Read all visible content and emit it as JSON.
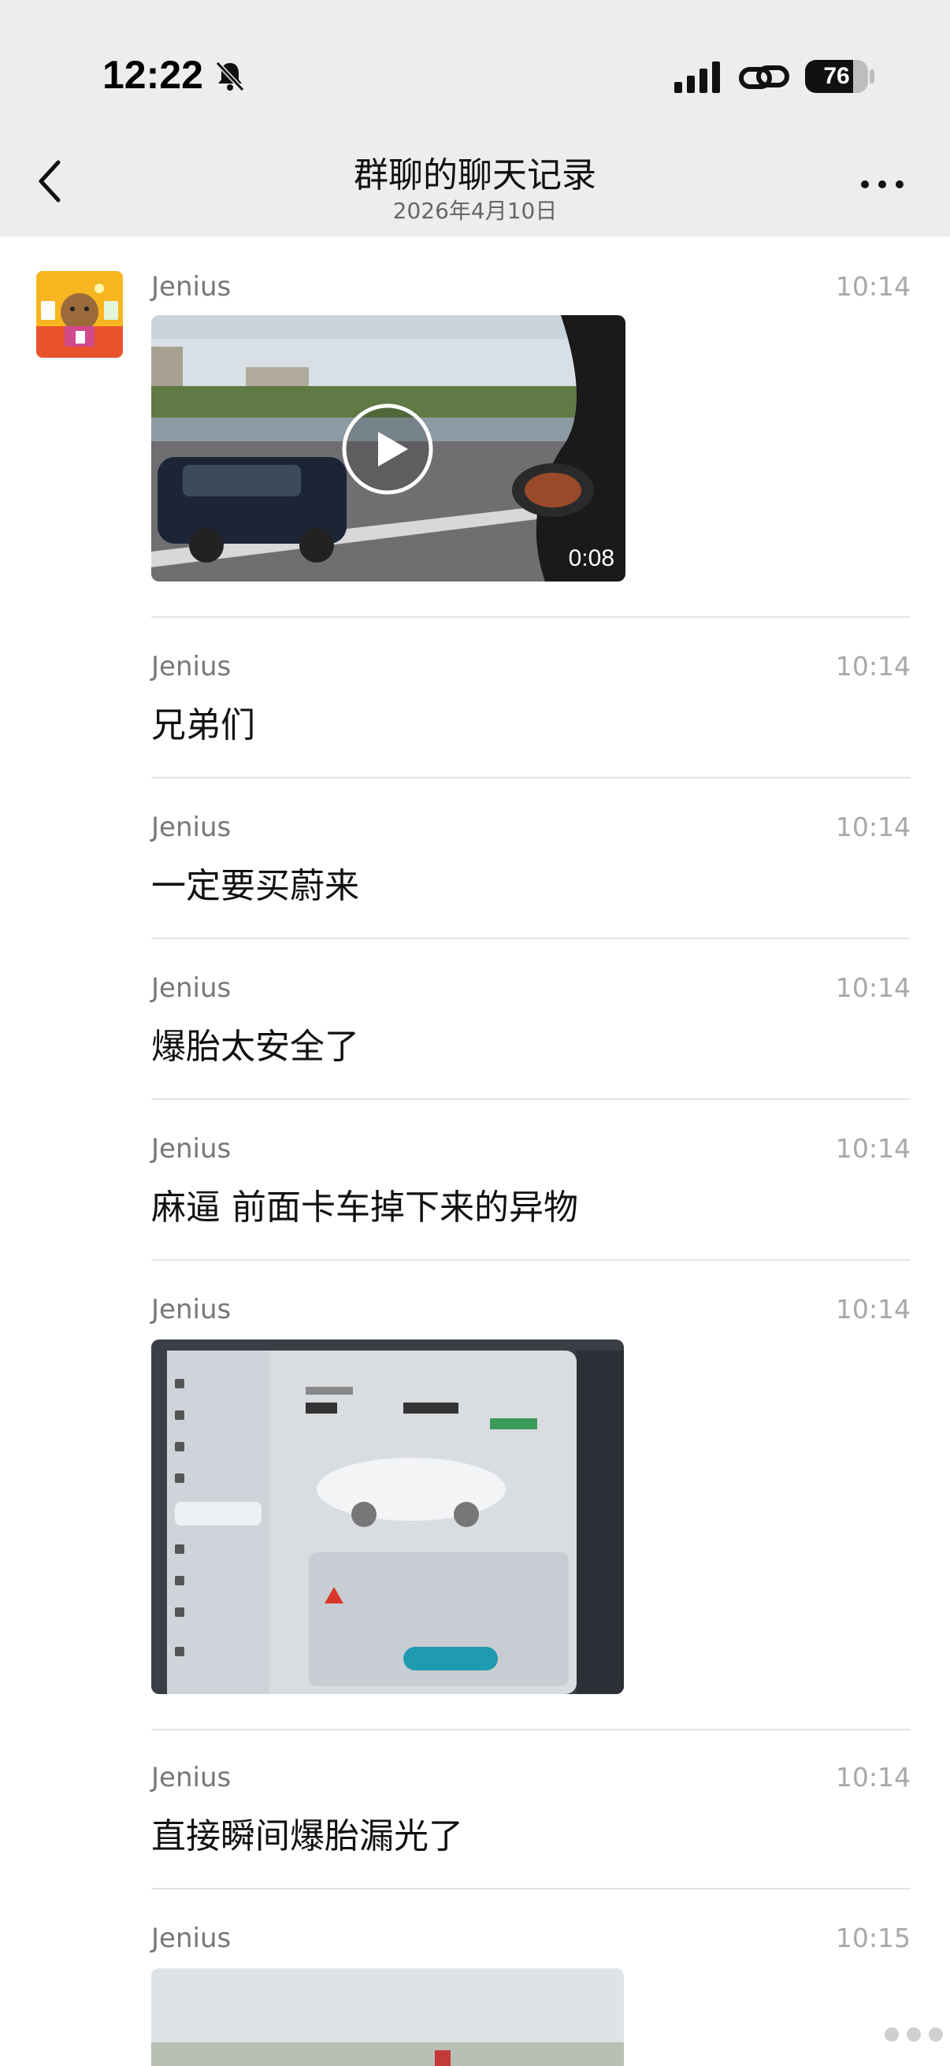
{
  "status_bar": {
    "time": "12:22",
    "battery": "76",
    "battery_level_percent": 76
  },
  "header": {
    "title": "群聊的聊天记录",
    "subtitle": "2026年4月10日"
  },
  "messages": [
    {
      "sender": "Jenius",
      "time": "10:14",
      "type": "video",
      "duration": "0:08"
    },
    {
      "sender": "Jenius",
      "time": "10:14",
      "type": "text",
      "text": "兄弟们"
    },
    {
      "sender": "Jenius",
      "time": "10:14",
      "type": "text",
      "text": "一定要买蔚来"
    },
    {
      "sender": "Jenius",
      "time": "10:14",
      "type": "text",
      "text": "爆胎太安全了"
    },
    {
      "sender": "Jenius",
      "time": "10:14",
      "type": "text",
      "text": "麻逼 前面卡车掉下来的异物"
    },
    {
      "sender": "Jenius",
      "time": "10:14",
      "type": "image"
    },
    {
      "sender": "Jenius",
      "time": "10:14",
      "type": "text",
      "text": "直接瞬间爆胎漏光了"
    },
    {
      "sender": "Jenius",
      "time": "10:15",
      "type": "image"
    }
  ],
  "colors": {
    "header_bg": "#ededed",
    "divider": "#e4e4e4",
    "name_gray": "#777777",
    "time_gray": "#a8a8a8"
  }
}
